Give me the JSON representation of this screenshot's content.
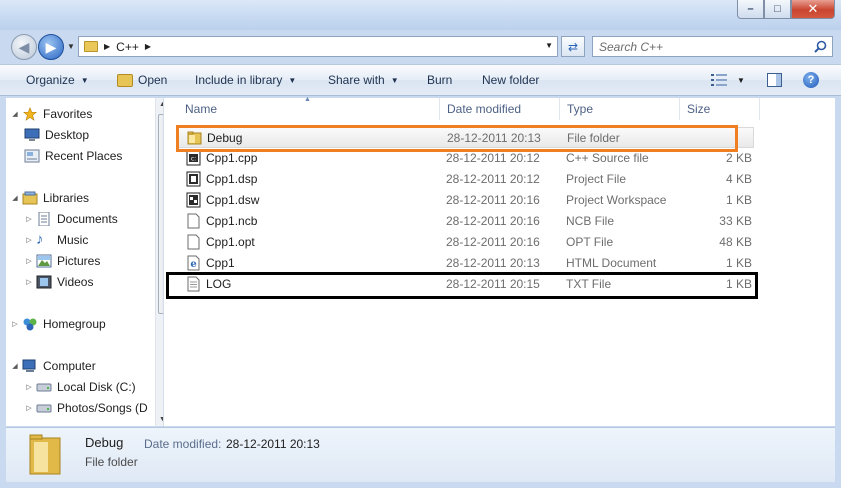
{
  "window": {
    "minimize_glyph": "–",
    "maximize_glyph": "□",
    "close_glyph": "✕"
  },
  "address": {
    "path": "C++",
    "search_placeholder": "Search C++"
  },
  "toolbar": {
    "organize": "Organize",
    "open": "Open",
    "include_in_library": "Include in library",
    "share_with": "Share with",
    "burn": "Burn",
    "new_folder": "New folder",
    "help": "?"
  },
  "nav": {
    "favorites": "Favorites",
    "desktop": "Desktop",
    "recent_places": "Recent Places",
    "libraries": "Libraries",
    "documents": "Documents",
    "music": "Music",
    "pictures": "Pictures",
    "videos": "Videos",
    "homegroup": "Homegroup",
    "computer": "Computer",
    "local_disk": "Local Disk (C:)",
    "photos_songs": "Photos/Songs (D"
  },
  "columns": {
    "name": "Name",
    "date_modified": "Date modified",
    "type": "Type",
    "size": "Size"
  },
  "files": [
    {
      "name": "Debug",
      "date": "28-12-2011 20:13",
      "type": "File folder",
      "size": "",
      "icon": "folder-icon"
    },
    {
      "name": "Cpp1.cpp",
      "date": "28-12-2011 20:12",
      "type": "C++ Source file",
      "size": "2 KB",
      "icon": "cpp-file-icon"
    },
    {
      "name": "Cpp1.dsp",
      "date": "28-12-2011 20:12",
      "type": "Project File",
      "size": "4 KB",
      "icon": "project-file-icon"
    },
    {
      "name": "Cpp1.dsw",
      "date": "28-12-2011 20:16",
      "type": "Project Workspace",
      "size": "1 KB",
      "icon": "workspace-file-icon"
    },
    {
      "name": "Cpp1.ncb",
      "date": "28-12-2011 20:16",
      "type": "NCB File",
      "size": "33 KB",
      "icon": "blank-file-icon"
    },
    {
      "name": "Cpp1.opt",
      "date": "28-12-2011 20:16",
      "type": "OPT File",
      "size": "48 KB",
      "icon": "blank-file-icon"
    },
    {
      "name": "Cpp1",
      "date": "28-12-2011 20:13",
      "type": "HTML Document",
      "size": "1 KB",
      "icon": "html-file-icon"
    },
    {
      "name": "LOG",
      "date": "28-12-2011 20:15",
      "type": "TXT File",
      "size": "1 KB",
      "icon": "text-file-icon"
    }
  ],
  "details": {
    "name": "Debug",
    "type": "File folder",
    "date_label": "Date modified:",
    "date_value": "28-12-2011 20:13"
  },
  "colors": {
    "highlight_orange": "#f07f22",
    "highlight_black": "#000000"
  }
}
